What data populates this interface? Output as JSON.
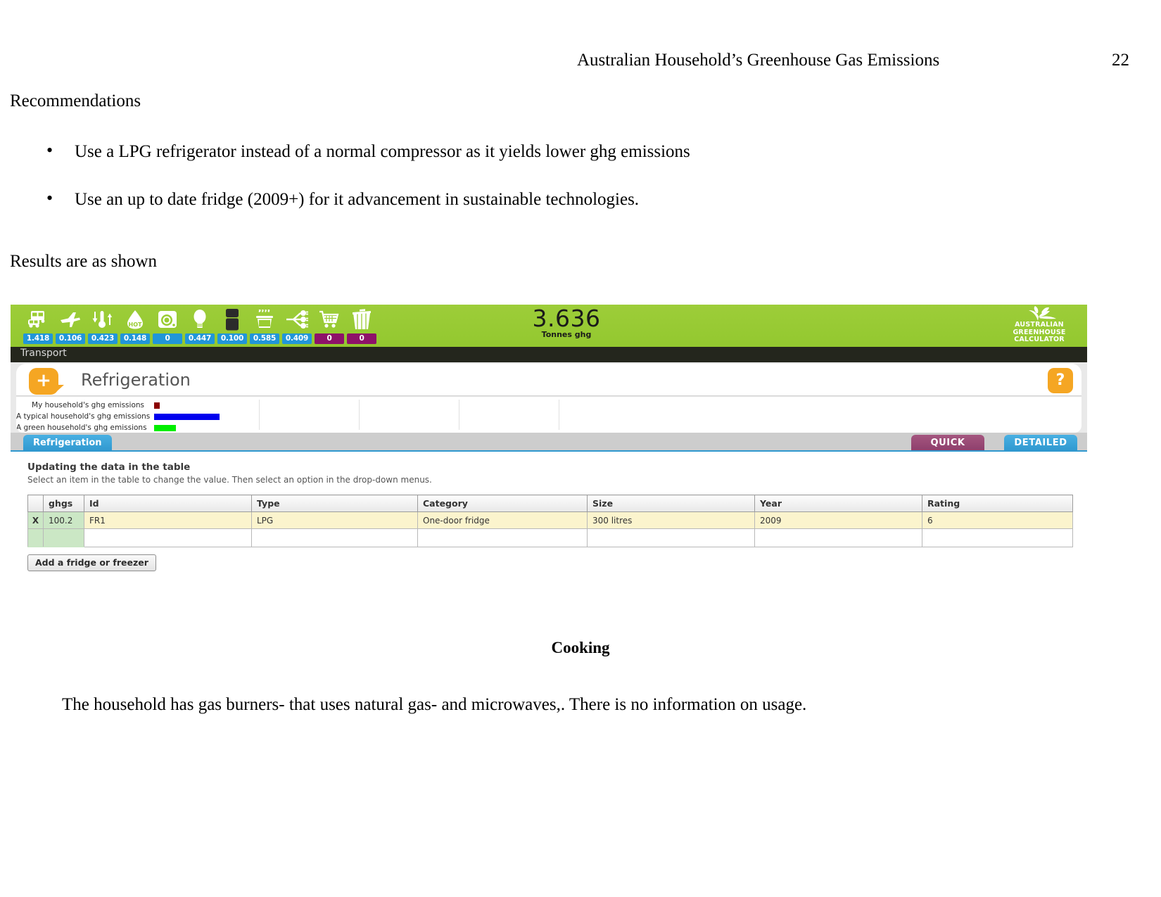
{
  "document": {
    "running_header": "Australian Household’s Greenhouse Gas Emissions",
    "page_number": "22",
    "section_title": "Recommendations",
    "bullets": [
      "Use a LPG refrigerator instead of a normal compressor as it yields lower ghg emissions",
      "Use an up to date fridge (2009+) for it advancement in sustainable technologies."
    ],
    "results_lead": "Results are as shown",
    "cooking_heading": "Cooking",
    "cooking_body": "The household has gas burners- that uses natural gas- and microwaves,. There is no information on usage."
  },
  "app": {
    "topbar": {
      "total_value": "3.636",
      "total_unit": "Tonnes ghg",
      "brand_line1": "AUSTRALIAN",
      "brand_line2": "GREENHOUSE",
      "brand_line3": "CALCULATOR",
      "categories": [
        {
          "icon": "bus-car-transport-icon",
          "value": "1.418",
          "accent": "#2196d8"
        },
        {
          "icon": "airplane-icon",
          "value": "0.106",
          "accent": "#2196d8"
        },
        {
          "icon": "thermometer-heating-cooling-icon",
          "value": "0.423",
          "accent": "#2196d8"
        },
        {
          "icon": "hot-water-drop-icon",
          "value": "0.148",
          "accent": "#2196d8"
        },
        {
          "icon": "washing-machine-icon",
          "value": "0",
          "accent": "#2196d8"
        },
        {
          "icon": "light-bulb-icon",
          "value": "0.447",
          "accent": "#2196d8"
        },
        {
          "icon": "refrigerator-icon",
          "value": "0.100",
          "accent": "#2196d8"
        },
        {
          "icon": "cooking-pot-icon",
          "value": "0.585",
          "accent": "#2196d8"
        },
        {
          "icon": "power-plug-appliances-icon",
          "value": "0.409",
          "accent": "#2196d8"
        },
        {
          "icon": "shopping-trolley-icon",
          "value": "0",
          "accent": "#8e1269"
        },
        {
          "icon": "waste-bin-icon",
          "value": "0",
          "accent": "#8e1269"
        }
      ]
    },
    "breadcrumb": "Transport",
    "panel": {
      "add_button_label": "+",
      "title": "Refrigeration",
      "help_button_label": "?"
    },
    "tabs": {
      "active_tab": "Refrigeration",
      "quick_label": "QUICK",
      "detailed_label": "DETAILED"
    },
    "instructions": {
      "title": "Updating the data in the table",
      "subtitle": "Select an item in the table to change the value. Then select an option in the drop-down menus."
    },
    "table": {
      "headers": [
        "",
        "ghgs",
        "Id",
        "Type",
        "Category",
        "Size",
        "Year",
        "Rating"
      ],
      "rows": [
        {
          "select": "X",
          "ghgs": "100.2",
          "id": "FR1",
          "type": "LPG",
          "category": "One-door fridge",
          "size": "300 litres",
          "year": "2009",
          "rating": "6"
        }
      ],
      "empty_row_cells": [
        "",
        "",
        "",
        "",
        "",
        "",
        "",
        ""
      ],
      "add_row_button": "Add a fridge or freezer"
    },
    "chart_data": {
      "type": "bar",
      "title": "Refrigeration ghg emissions comparison",
      "orientation": "horizontal",
      "categories": [
        "My household's ghg emissions",
        "A typical household's ghg emissions",
        "A green household's ghg emissions"
      ],
      "values": [
        0.1,
        1.0,
        0.3
      ],
      "colors": [
        "#8b0000",
        "#0000ee",
        "#00ee00"
      ],
      "xlabel": "",
      "ylabel": "",
      "xlim": [
        0,
        5
      ],
      "grid": true,
      "gridline_positions": [
        1,
        2,
        3,
        4
      ],
      "legend": "inline-left-labels",
      "unit": "tonnes ghg"
    }
  }
}
